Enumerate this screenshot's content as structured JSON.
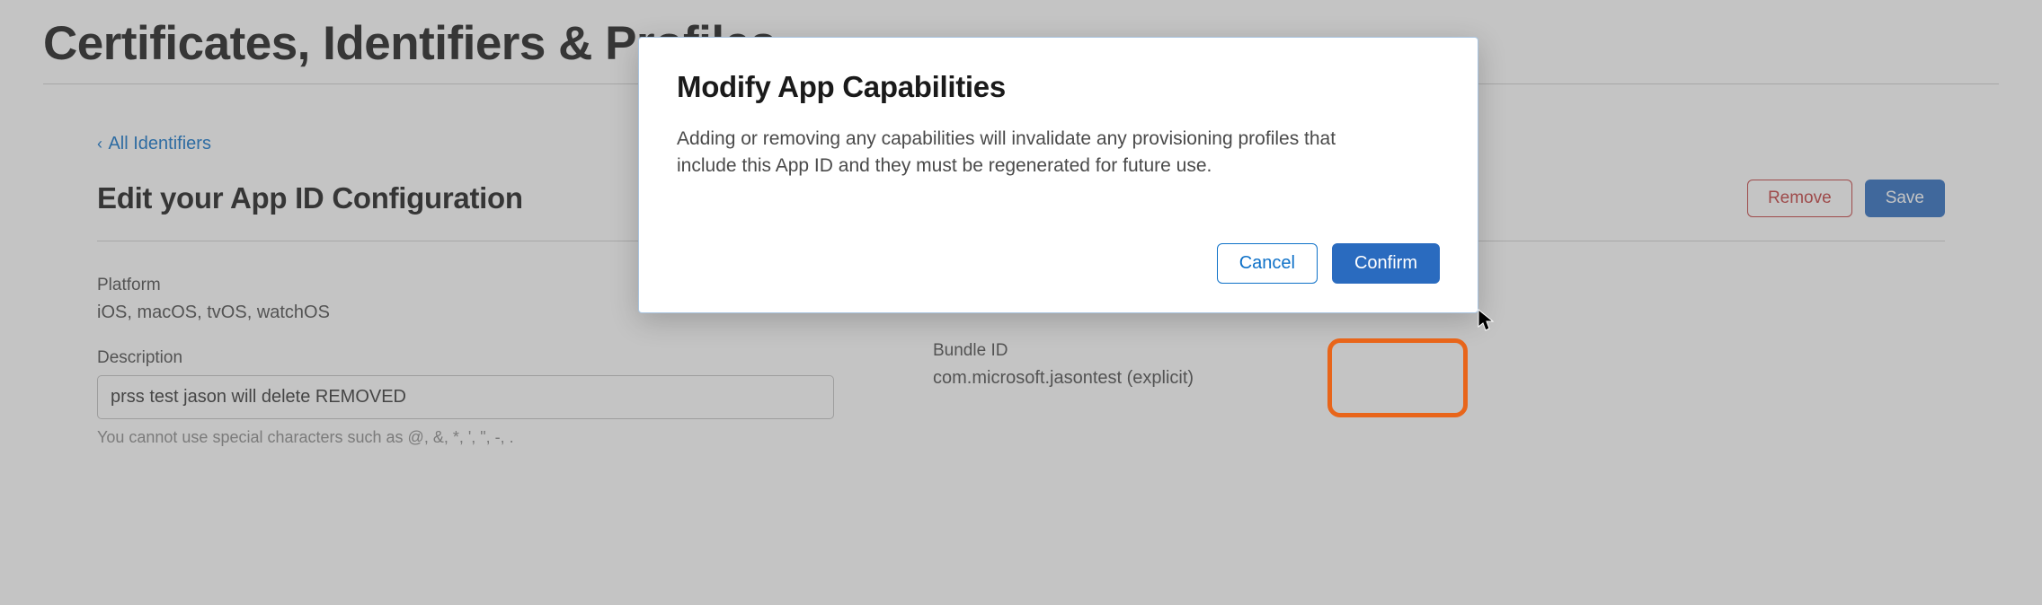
{
  "page": {
    "title": "Certificates, Identifiers & Profiles",
    "back_link": "All Identifiers",
    "section_title": "Edit your App ID Configuration",
    "buttons": {
      "remove": "Remove",
      "save": "Save"
    }
  },
  "details": {
    "platform_label": "Platform",
    "platform_value": "iOS, macOS, tvOS, watchOS",
    "description_label": "Description",
    "description_value": "prss test jason will delete REMOVED",
    "description_help": "You cannot use special characters such as @, &, *, ', \", -, .",
    "bundle_label": "Bundle ID",
    "bundle_value": "com.microsoft.jasontest (explicit)"
  },
  "modal": {
    "title": "Modify App Capabilities",
    "body": "Adding or removing any capabilities will invalidate any provisioning profiles that include this App ID and they must be regenerated for future use.",
    "cancel": "Cancel",
    "confirm": "Confirm"
  }
}
